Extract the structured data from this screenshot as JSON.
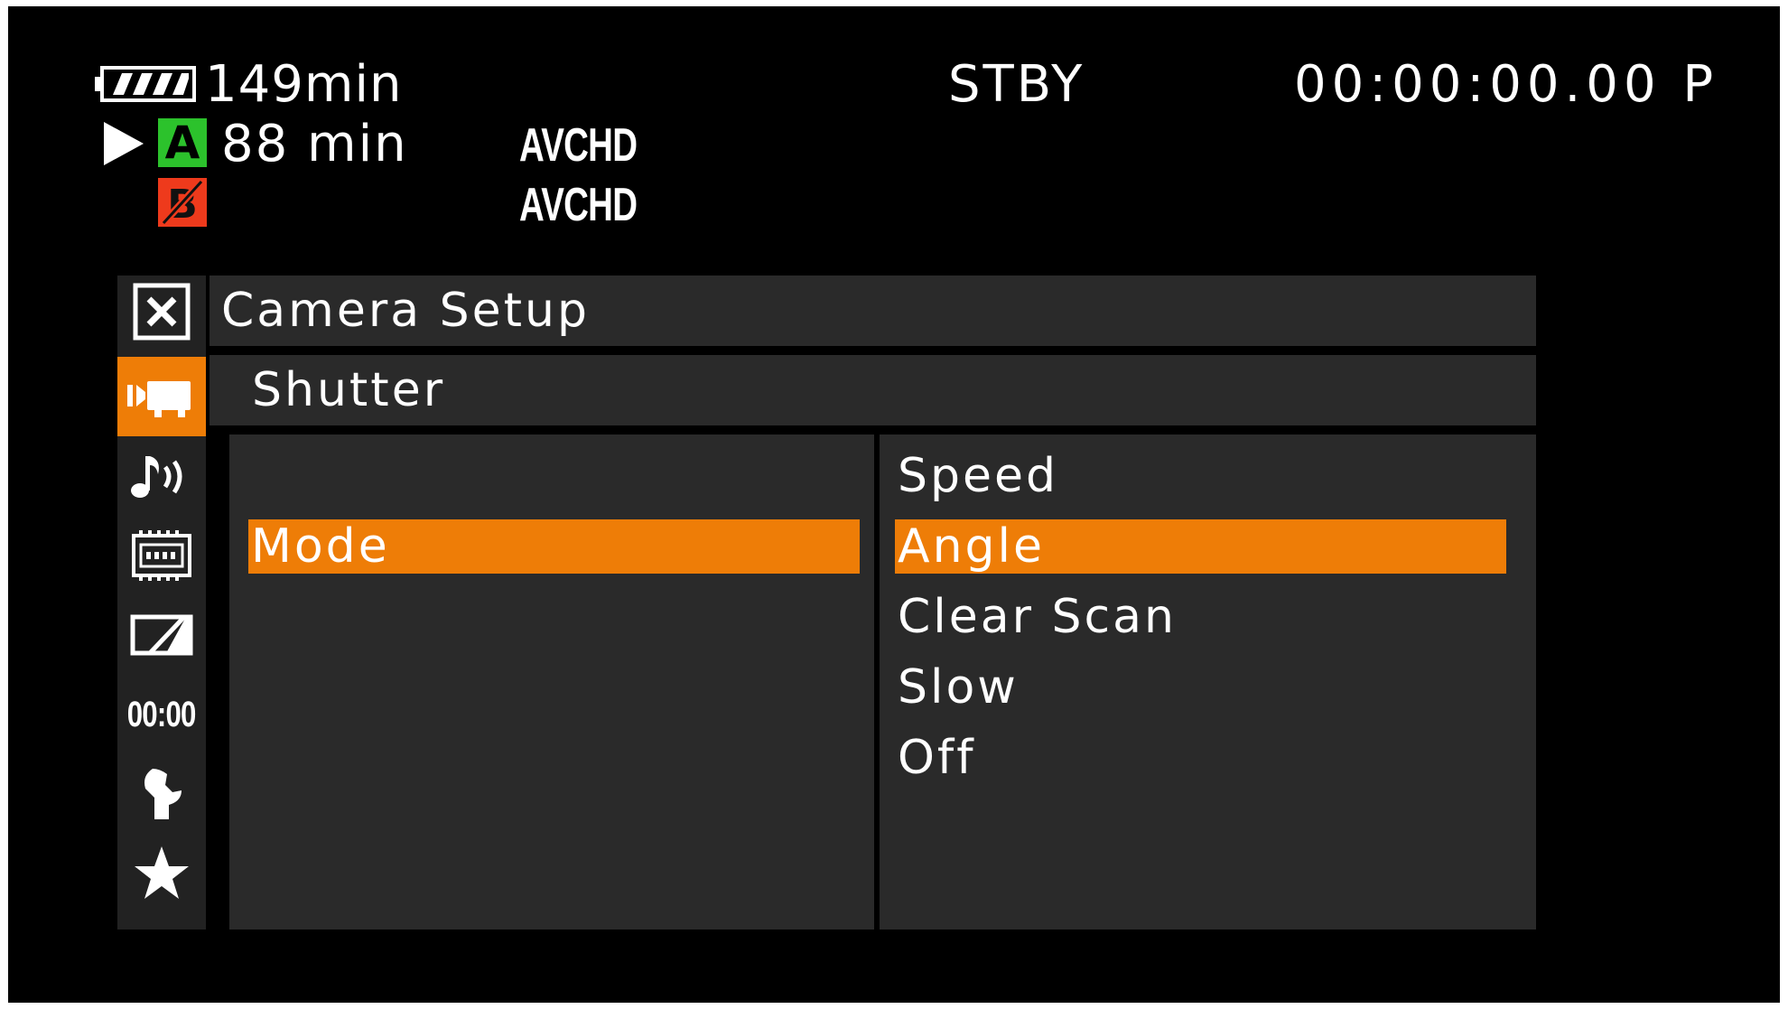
{
  "status": {
    "battery_icon": "battery-full-icon",
    "battery_time": "149min",
    "mode": "STBY",
    "timecode": "00:00:00.00 P",
    "slot_a": {
      "icon": "play-icon",
      "letter": "A",
      "time": "88 min",
      "format": "AVCHD",
      "color": "#2cc22c"
    },
    "slot_b": {
      "icon": "card-b-no-media-icon",
      "letter": "B",
      "format": "AVCHD",
      "color": "#ee3a1c"
    }
  },
  "menu": {
    "close_icon": "close-icon",
    "title": "Camera Setup",
    "submenu": "Shutter",
    "sidebar": [
      {
        "icon": "camera-setup-icon",
        "active": true
      },
      {
        "icon": "audio-setup-icon",
        "active": false
      },
      {
        "icon": "video-setup-icon",
        "active": false
      },
      {
        "icon": "lcd-setup-icon",
        "active": false
      },
      {
        "icon": "tc-ub-setup-icon",
        "label": "00:00",
        "active": false
      },
      {
        "icon": "other-functions-icon",
        "active": false
      },
      {
        "icon": "my-menu-icon",
        "active": false
      }
    ],
    "left_options": [
      {
        "label": "Mode",
        "selected": true
      }
    ],
    "right_options": [
      {
        "label": "Speed",
        "selected": false
      },
      {
        "label": "Angle",
        "selected": true
      },
      {
        "label": "Clear Scan",
        "selected": false
      },
      {
        "label": "Slow",
        "selected": false
      },
      {
        "label": "Off",
        "selected": false
      }
    ]
  },
  "colors": {
    "accent": "#ee7d07",
    "background": "#000000",
    "panel": "#2a2a2a"
  }
}
